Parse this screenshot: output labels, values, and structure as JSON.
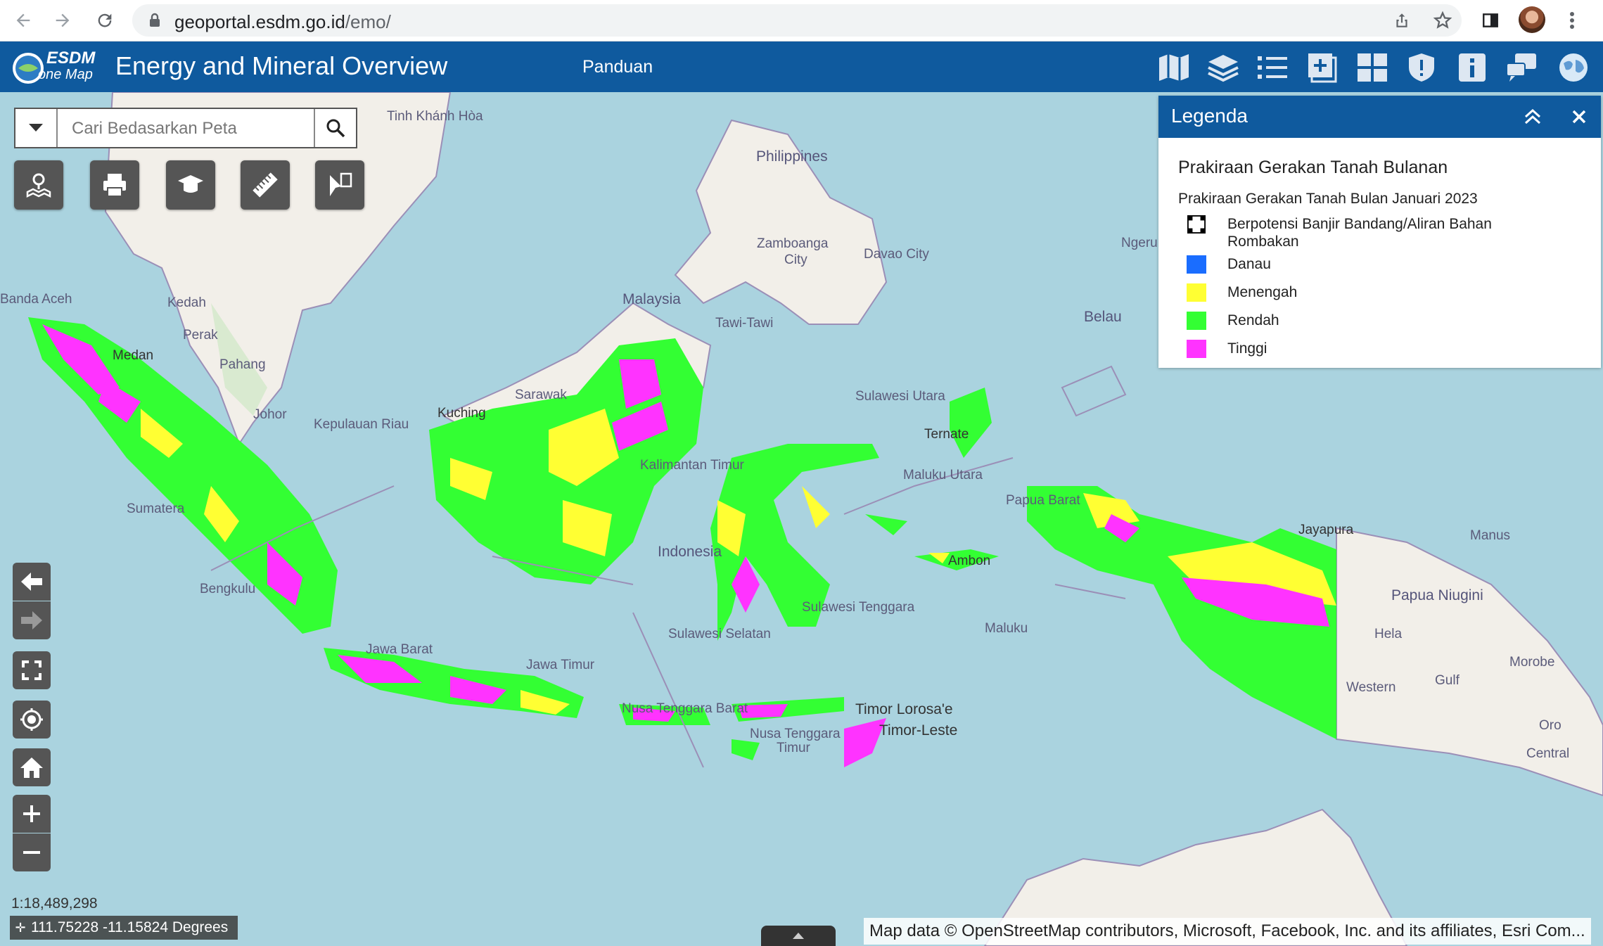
{
  "browser": {
    "url_host": "geoportal.esdm.go.id",
    "url_path": "/emo/",
    "icons": [
      "back-icon",
      "forward-icon",
      "reload-icon",
      "lock-icon",
      "share-icon",
      "star-icon",
      "sidebar-icon",
      "menu-dots-icon"
    ]
  },
  "app": {
    "logo_text_top": "ESDM",
    "logo_text_bottom": "one Map",
    "title": "Energy and Mineral Overview",
    "nav_link": "Panduan",
    "header_icons": [
      "basemap-icon",
      "layers-icon",
      "layer-list-icon",
      "add-data-icon",
      "widgets-icon",
      "shield-icon",
      "info-icon",
      "chat-icon",
      "globe-icon"
    ],
    "accent_color": "#0f5a9e"
  },
  "search": {
    "placeholder": "Cari Bedasarkan Peta"
  },
  "tools": [
    "map-pin-icon",
    "print-icon",
    "education-icon",
    "ruler-icon",
    "draw-icon"
  ],
  "map_controls": [
    "back-arrow-icon",
    "forward-arrow-icon",
    "fullscreen-icon",
    "locate-icon",
    "home-icon",
    "zoom-in-icon",
    "zoom-out-icon"
  ],
  "map": {
    "scale": "1:18,489,298",
    "coordinates": "111.75228 -11.15824 Degrees",
    "attribution": "Map data © OpenStreetMap contributors, Microsoft, Facebook, Inc. and its affiliates, Esri Com...",
    "labels": [
      {
        "text": "Tinh Khánh Hòa",
        "name": "label-khanh-hoa"
      },
      {
        "text": "Philippines",
        "name": "label-philippines"
      },
      {
        "text": "Zamboanga",
        "name": "label-zamboanga"
      },
      {
        "text": "City",
        "name": "label-zamboanga-city"
      },
      {
        "text": "Davao City",
        "name": "label-davao"
      },
      {
        "text": "Ngeru",
        "name": "label-ngeru"
      },
      {
        "text": "Belau",
        "name": "label-belau"
      },
      {
        "text": "Banda Aceh",
        "name": "label-banda-aceh"
      },
      {
        "text": "Kedah",
        "name": "label-kedah"
      },
      {
        "text": "Perak",
        "name": "label-perak"
      },
      {
        "text": "Pahang",
        "name": "label-pahang"
      },
      {
        "text": "Johor",
        "name": "label-johor"
      },
      {
        "text": "Kepulauan Riau",
        "name": "label-kepri"
      },
      {
        "text": "Malaysia",
        "name": "label-malaysia"
      },
      {
        "text": "Tawi-Tawi",
        "name": "label-tawi"
      },
      {
        "text": "Sarawak",
        "name": "label-sarawak"
      },
      {
        "text": "Kuching",
        "name": "label-kuching"
      },
      {
        "text": "Sulawesi Utara",
        "name": "label-sulut"
      },
      {
        "text": "Ternate",
        "name": "label-ternate"
      },
      {
        "text": "Maluku Utara",
        "name": "label-malut"
      },
      {
        "text": "Papua Barat",
        "name": "label-papbar"
      },
      {
        "text": "Jayapura",
        "name": "label-jayapura"
      },
      {
        "text": "Manus",
        "name": "label-manus"
      },
      {
        "text": "Papua Niugini",
        "name": "label-png"
      },
      {
        "text": "Hela",
        "name": "label-hela"
      },
      {
        "text": "Morobe",
        "name": "label-morobe"
      },
      {
        "text": "Gulf",
        "name": "label-gulf"
      },
      {
        "text": "Western",
        "name": "label-western"
      },
      {
        "text": "Oro",
        "name": "label-oro"
      },
      {
        "text": "Central",
        "name": "label-central"
      },
      {
        "text": "Ambon",
        "name": "label-ambon"
      },
      {
        "text": "Maluku",
        "name": "label-maluku"
      },
      {
        "text": "Indonesia",
        "name": "label-indonesia"
      },
      {
        "text": "Sulawesi Selatan",
        "name": "label-sulsel"
      },
      {
        "text": "Sulawesi Tenggara",
        "name": "label-sultra"
      },
      {
        "text": "Kalimantan Timur",
        "name": "label-kaltim"
      },
      {
        "text": "Jawa Timur",
        "name": "label-jatim"
      },
      {
        "text": "Jawa Barat",
        "name": "label-jabar"
      },
      {
        "text": "Nusa Tenggara Barat",
        "name": "label-ntb"
      },
      {
        "text": "Nusa Tenggara",
        "name": "label-ntt"
      },
      {
        "text": "Timur",
        "name": "label-ntt-timur"
      },
      {
        "text": "Timor Lorosa'e",
        "name": "label-timor-lorosae"
      },
      {
        "text": "Timor-Leste",
        "name": "label-timor-leste"
      },
      {
        "text": "Sumatera",
        "name": "label-sumatera"
      },
      {
        "text": "Bengkulu",
        "name": "label-bengkulu"
      },
      {
        "text": "Medan",
        "name": "label-medan"
      }
    ]
  },
  "legend": {
    "title": "Legenda",
    "layer_title": "Prakiraan Gerakan Tanah Bulanan",
    "sublayer_title": "Prakiraan Gerakan Tanah Bulan Januari 2023",
    "items": [
      {
        "label": "Berpotensi Banjir Bandang/Aliran Bahan Rombakan",
        "color": "pattern"
      },
      {
        "label": "Danau",
        "color": "#1a6dff"
      },
      {
        "label": "Menengah",
        "color": "#ffff33"
      },
      {
        "label": "Rendah",
        "color": "#33ff33"
      },
      {
        "label": "Tinggi",
        "color": "#ff33ff"
      }
    ]
  }
}
